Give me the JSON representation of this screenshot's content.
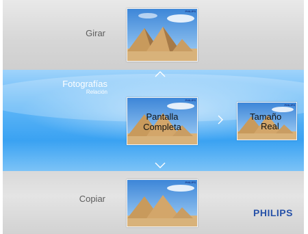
{
  "menu": {
    "top_item": "Girar",
    "middle_item": {
      "title": "Fotografías",
      "subtitle": "Relación"
    },
    "bottom_item": "Copiar"
  },
  "options": {
    "current": {
      "line1": "Pantalla",
      "line2": "Completa"
    },
    "next": {
      "line1": "Tamaño",
      "line2": "Real"
    }
  },
  "brand": {
    "thumb_mark": "PHILIPS",
    "logo": "PHILIPS"
  },
  "icons": {
    "up": "chevron-up-icon",
    "down": "chevron-down-icon",
    "right": "chevron-right-icon"
  },
  "colors": {
    "accent": "#3aa2f2",
    "brand": "#2651a8"
  }
}
